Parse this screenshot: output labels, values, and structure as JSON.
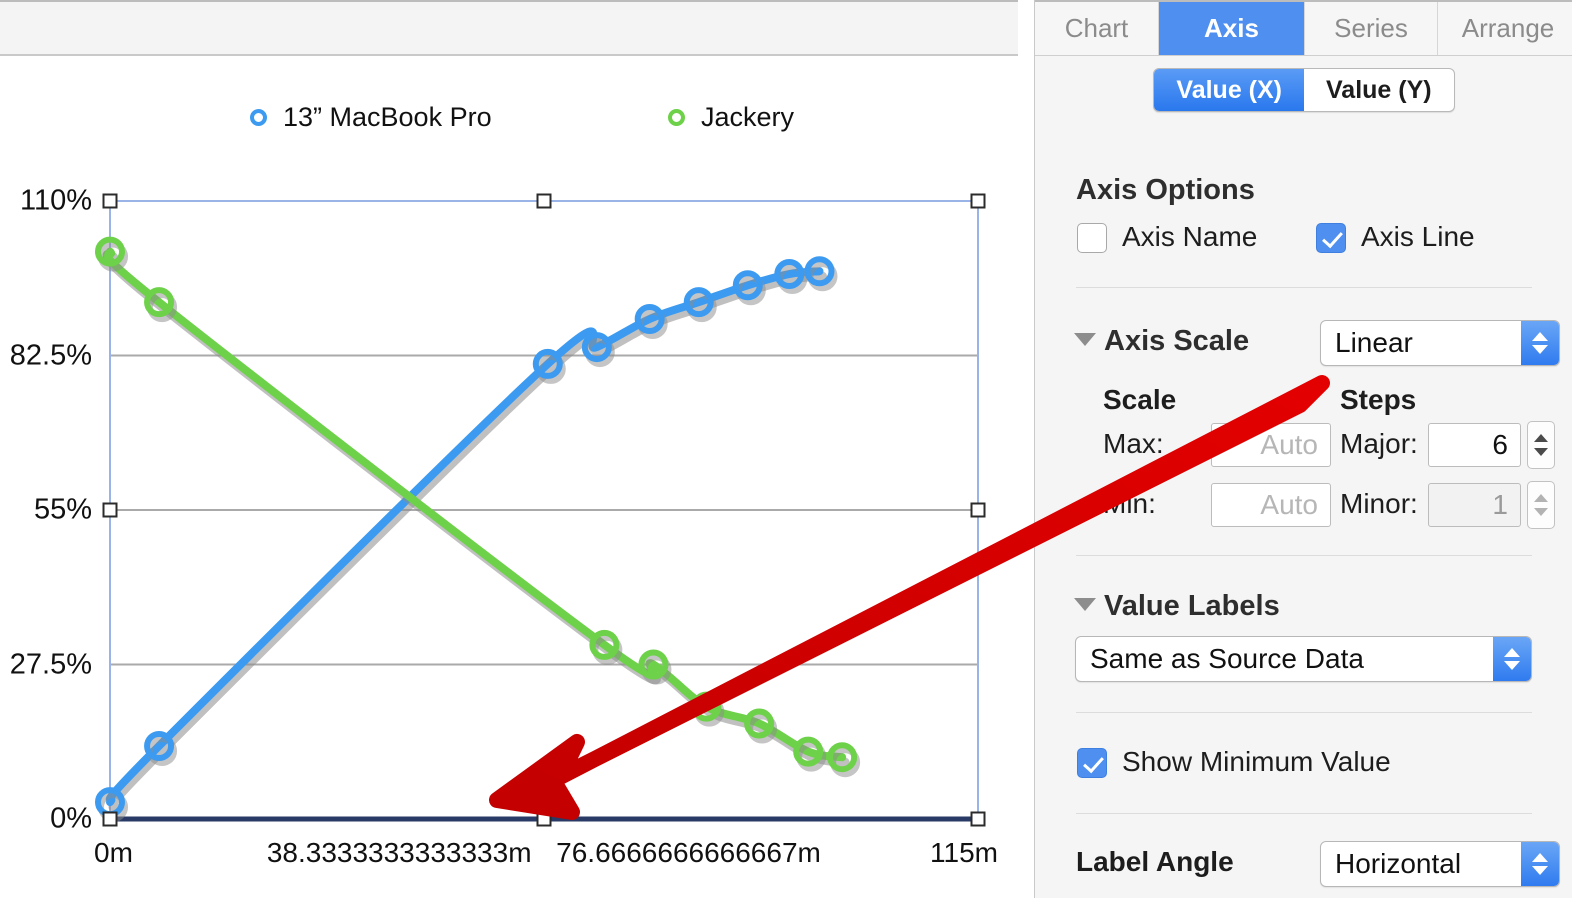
{
  "chart_data": {
    "type": "line",
    "title": "",
    "xlabel": "",
    "ylabel": "",
    "x_tick_labels": [
      "0m",
      "38.3333333333333m",
      "76.6666666666667m",
      "115m"
    ],
    "x_tick_values": [
      0,
      38.3333333333333,
      76.6666666666667,
      115
    ],
    "y_tick_labels": [
      "0%",
      "27.5%",
      "55%",
      "82.5%",
      "110%"
    ],
    "y_tick_values": [
      0,
      27.5,
      55,
      82.5,
      110
    ],
    "xlim": [
      0,
      115
    ],
    "ylim": [
      0,
      110
    ],
    "grid": true,
    "legend_position": "top",
    "series": [
      {
        "name": "13” MacBook Pro",
        "color": "#3c9bf0",
        "points": [
          {
            "x": 0,
            "y": 3
          },
          {
            "x": 6.5,
            "y": 13
          },
          {
            "x": 58,
            "y": 81
          },
          {
            "x": 64.5,
            "y": 84
          },
          {
            "x": 71.5,
            "y": 89
          },
          {
            "x": 78,
            "y": 92
          },
          {
            "x": 84.5,
            "y": 95
          },
          {
            "x": 90,
            "y": 97
          },
          {
            "x": 94,
            "y": 97.5
          }
        ]
      },
      {
        "name": "Jackery",
        "color": "#6ed14a",
        "points": [
          {
            "x": 0,
            "y": 101
          },
          {
            "x": 6.5,
            "y": 92
          },
          {
            "x": 65.5,
            "y": 31
          },
          {
            "x": 72,
            "y": 27.5
          },
          {
            "x": 79,
            "y": 20
          },
          {
            "x": 86,
            "y": 17
          },
          {
            "x": 92.5,
            "y": 12
          },
          {
            "x": 97,
            "y": 11
          }
        ]
      }
    ]
  },
  "legend": {
    "items": [
      {
        "label": "13” MacBook Pro",
        "color": "#3c9bf0"
      },
      {
        "label": "Jackery",
        "color": "#6ed14a"
      }
    ]
  },
  "inspector": {
    "tabs": [
      {
        "label": "Chart",
        "active": false
      },
      {
        "label": "Axis",
        "active": true
      },
      {
        "label": "Series",
        "active": false
      },
      {
        "label": "Arrange",
        "active": false
      }
    ],
    "segmented": [
      {
        "label": "Value (X)",
        "active": true
      },
      {
        "label": "Value (Y)",
        "active": false
      }
    ],
    "axis_options": {
      "title": "Axis Options",
      "axis_name": {
        "label": "Axis Name",
        "checked": false
      },
      "axis_line": {
        "label": "Axis Line",
        "checked": true
      }
    },
    "axis_scale": {
      "title": "Axis Scale",
      "scale_type": "Linear",
      "scale_group_label": "Scale",
      "steps_group_label": "Steps",
      "max": {
        "label": "Max:",
        "value": "",
        "placeholder": "Auto"
      },
      "min": {
        "label": "Min:",
        "value": "",
        "placeholder": "Auto"
      },
      "major": {
        "label": "Major:",
        "value": "6"
      },
      "minor": {
        "label": "Minor:",
        "value": "1"
      }
    },
    "value_labels": {
      "title": "Value Labels",
      "format": "Same as Source Data",
      "show_minimum_value": {
        "label": "Show Minimum Value",
        "checked": true
      }
    },
    "label_angle": {
      "label": "Label Angle",
      "value": "Horizontal"
    }
  },
  "annotation": {
    "highlight_color": "#e21212",
    "arrow_color": "#e00000"
  }
}
